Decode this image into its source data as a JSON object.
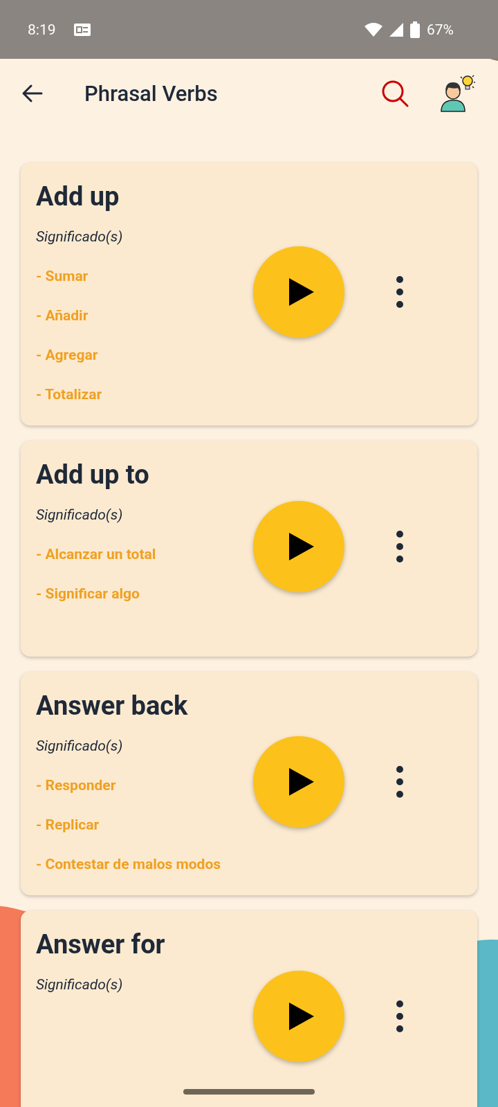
{
  "status_bar": {
    "time": "8:19",
    "battery": "67%"
  },
  "header": {
    "title": "Phrasal Verbs"
  },
  "cards": [
    {
      "title": "Add up",
      "meanings_label": "Significado(s)",
      "meanings": [
        "- Sumar",
        "- Añadir",
        "- Agregar",
        "- Totalizar"
      ]
    },
    {
      "title": "Add up to",
      "meanings_label": "Significado(s)",
      "meanings": [
        "- Alcanzar un total",
        "- Significar algo"
      ]
    },
    {
      "title": "Answer back",
      "meanings_label": "Significado(s)",
      "meanings": [
        "- Responder",
        "- Replicar",
        "- Contestar de malos modos"
      ]
    },
    {
      "title": "Answer for",
      "meanings_label": "Significado(s)"
    }
  ]
}
